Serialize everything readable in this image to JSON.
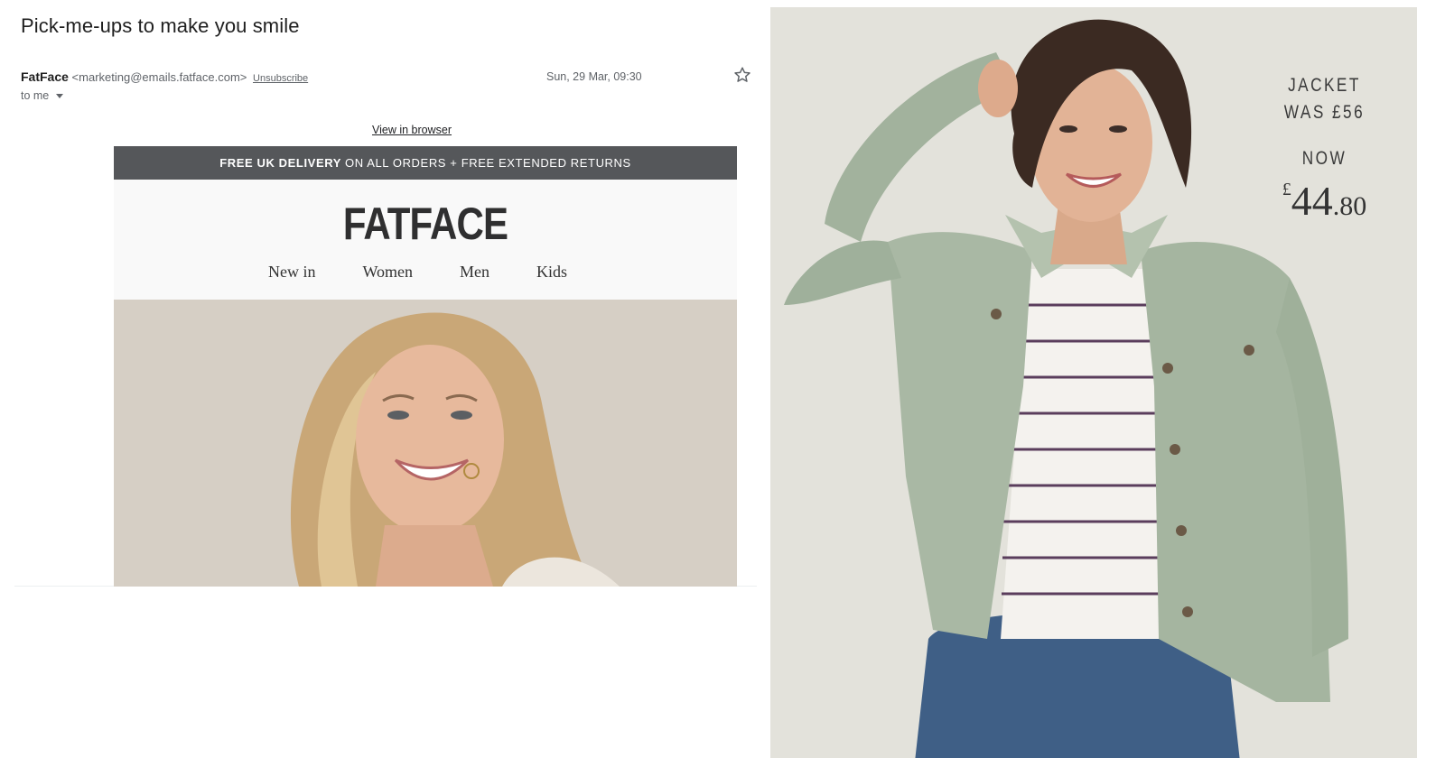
{
  "email": {
    "subject": "Pick-me-ups to make you smile",
    "sender_name": "FatFace",
    "sender_email": "<marketing@emails.fatface.com>",
    "unsubscribe_label": "Unsubscribe",
    "date": "Sun, 29 Mar, 09:30",
    "recipient": "to me",
    "star_icon": "star-outline-icon"
  },
  "newsletter": {
    "view_in_browser": "View in browser",
    "promo_bold": "FREE UK DELIVERY",
    "promo_rest": "ON ALL ORDERS + FREE EXTENDED RETURNS",
    "promo_color": "#55575a",
    "brand_logo": "FATFACE",
    "nav": [
      "New in",
      "Women",
      "Men",
      "Kids"
    ]
  },
  "product": {
    "item": "JACKET",
    "was": "WAS £56",
    "now_label": "NOW",
    "currency": "£",
    "price_whole": "44",
    "price_decimal": ".80"
  }
}
